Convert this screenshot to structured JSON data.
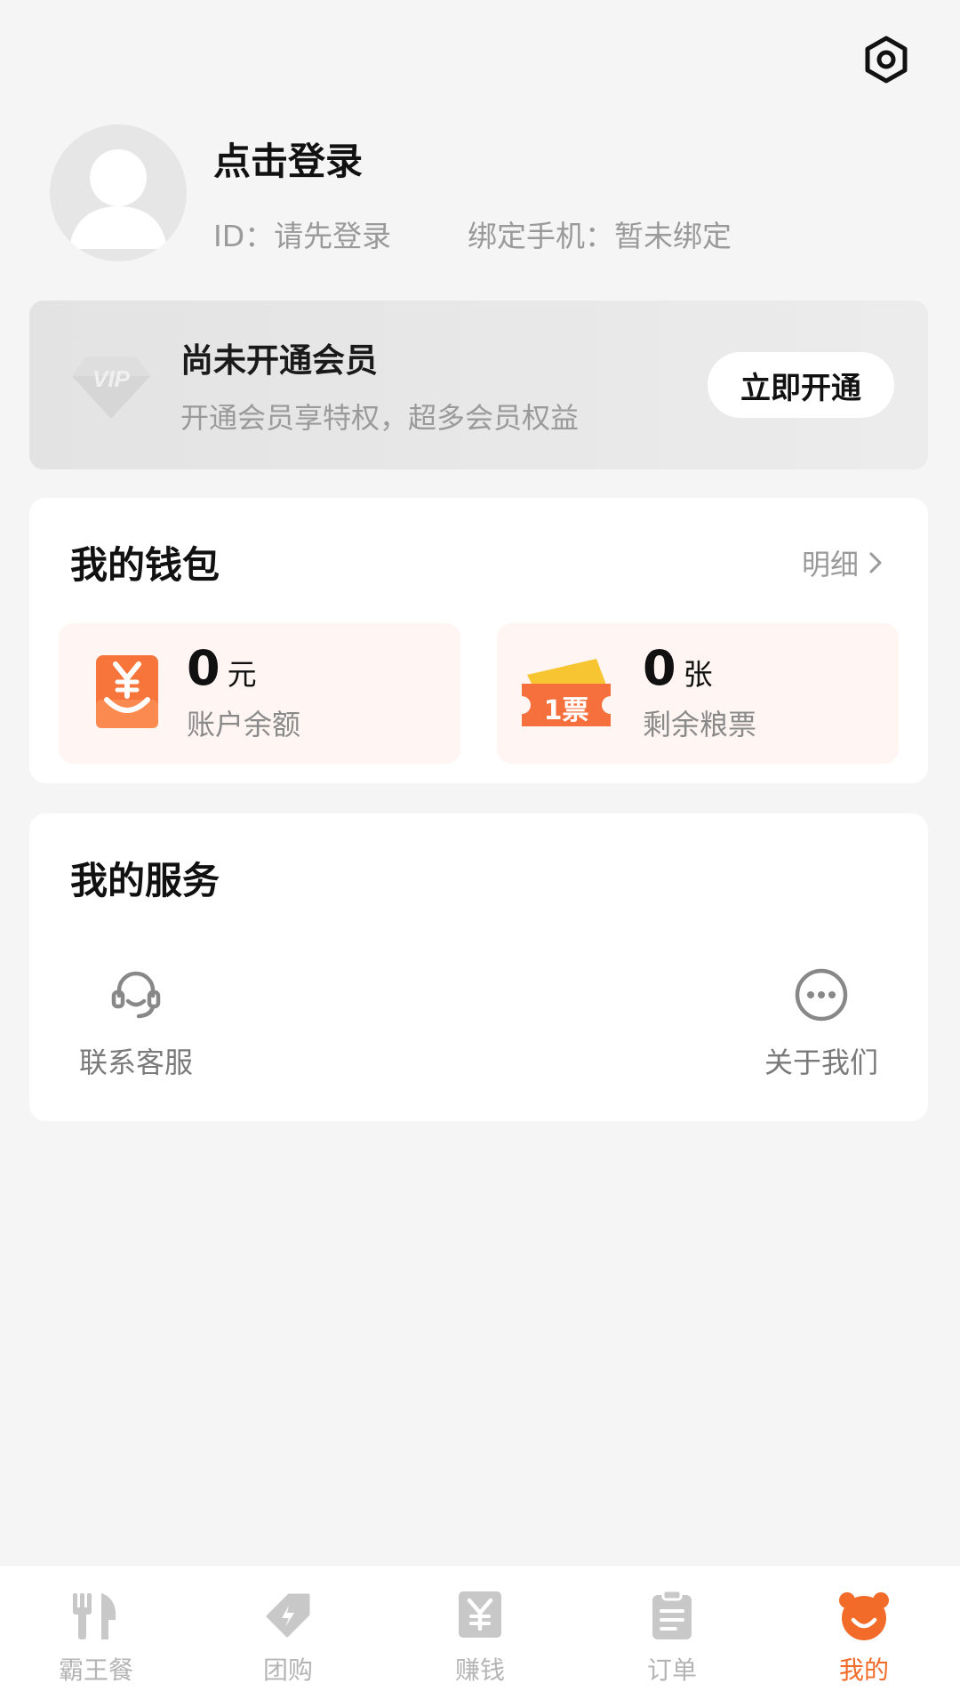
{
  "profile": {
    "login_title": "点击登录",
    "id_text": "ID：请先登录",
    "phone_text": "绑定手机：暂未绑定"
  },
  "vip": {
    "badge_text": "VIP",
    "title": "尚未开通会员",
    "subtitle": "开通会员享特权，超多会员权益",
    "button_label": "立即开通"
  },
  "wallet": {
    "title": "我的钱包",
    "detail_label": "明细",
    "balance": {
      "amount": "0",
      "unit": "元",
      "label": "账户余额"
    },
    "tickets": {
      "amount": "0",
      "unit": "张",
      "label": "剩余粮票",
      "icon_text": "1票"
    }
  },
  "services": {
    "title": "我的服务",
    "items": [
      {
        "label": "联系客服",
        "icon": "headset-icon"
      },
      {
        "label": "关于我们",
        "icon": "more-dots-icon"
      }
    ]
  },
  "tabs": [
    {
      "label": "霸王餐",
      "icon": "fork-knife-icon",
      "active": false
    },
    {
      "label": "团购",
      "icon": "tag-bolt-icon",
      "active": false
    },
    {
      "label": "赚钱",
      "icon": "yen-bag-icon",
      "active": false
    },
    {
      "label": "订单",
      "icon": "clipboard-icon",
      "active": false
    },
    {
      "label": "我的",
      "icon": "bear-icon",
      "active": true
    }
  ],
  "colors": {
    "accent": "#f26b29",
    "inactive_tab": "#b4b4b4",
    "page_bg": "#f5f5f5"
  }
}
